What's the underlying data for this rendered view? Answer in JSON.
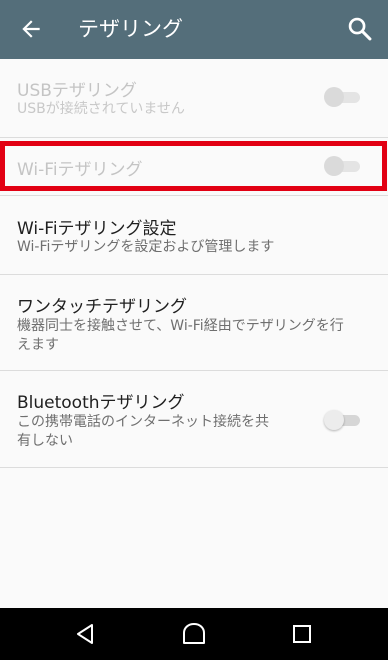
{
  "appbar": {
    "title": "テザリング",
    "back_icon": "arrow-back-icon",
    "search_icon": "search-icon",
    "color": "#546e7a"
  },
  "settings": [
    {
      "title": "USBテザリング",
      "subtitle": "USBが接続されていません",
      "enabled": false,
      "switch_on": false
    },
    {
      "title": "Wi-Fiテザリング",
      "subtitle": "",
      "enabled": false,
      "switch_on": false,
      "highlighted": true,
      "highlight_color": "#e20013"
    },
    {
      "title": "Wi-Fiテザリング設定",
      "subtitle": "Wi-Fiテザリングを設定および管理します"
    },
    {
      "title": "ワンタッチテザリング",
      "subtitle_line1": "機器同士を接触させて、Wi-Fi経由でテザリングを行",
      "subtitle_line2": "えます"
    },
    {
      "title": "Bluetoothテザリング",
      "subtitle_line1": "この携帯電話のインターネット接続を共",
      "subtitle_line2": "有しない",
      "enabled": true,
      "switch_on": false
    }
  ],
  "navbar": {
    "back_icon": "nav-back-icon",
    "home_icon": "nav-home-icon",
    "recents_icon": "nav-recents-icon"
  }
}
